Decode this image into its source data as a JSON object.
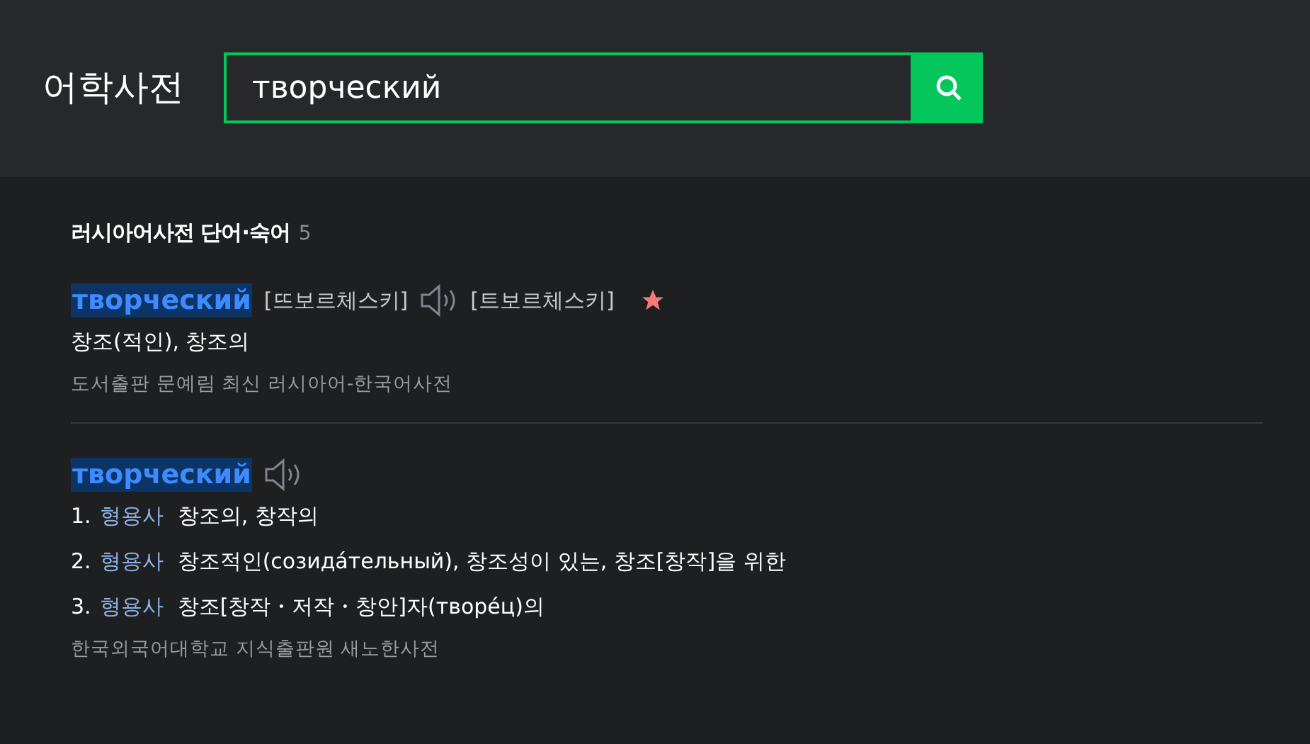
{
  "header": {
    "title": "어학사전",
    "search": {
      "value": "творческий"
    }
  },
  "section": {
    "title": "러시아어사전 단어·숙어",
    "count": "5"
  },
  "entries": [
    {
      "headword": "творческий",
      "highlighted": true,
      "starred": true,
      "head_items": [
        {
          "kind": "pronunciation",
          "text": "[뜨보르체스키]"
        },
        {
          "kind": "audio"
        },
        {
          "kind": "pronunciation",
          "text": "[트보르체스키]"
        }
      ],
      "meanings": [
        {
          "text": "창조(적인), 창조의"
        }
      ],
      "source": "도서출판 문예림 최신 러시아어-한국어사전"
    },
    {
      "headword": "творческий",
      "highlighted": true,
      "starred": false,
      "head_items": [
        {
          "kind": "audio"
        }
      ],
      "meanings": [
        {
          "number": "1.",
          "pos": "형용사",
          "text": "창조의, 창작의"
        },
        {
          "number": "2.",
          "pos": "형용사",
          "text": "창조적인(созида́тельный), 창조성이 있는, 창조[창작]을 위한"
        },
        {
          "number": "3.",
          "pos": "형용사",
          "text": "창조[창작・저작・창안]자(творе́ц)의"
        }
      ],
      "source": "한국외국어대학교 지식출판원 새노한사전"
    }
  ]
}
